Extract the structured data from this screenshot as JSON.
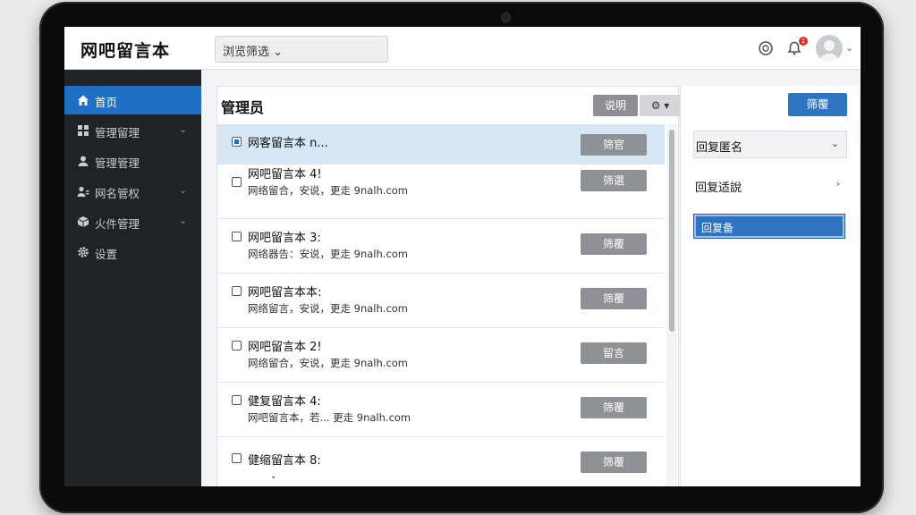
{
  "header": {
    "app_title": "网吧留言本",
    "search_dropdown": "浏览筛选 ⌄",
    "notification_count": "1"
  },
  "sidebar": {
    "items": [
      {
        "label": "首页",
        "icon": "home-icon",
        "active": true,
        "expandable": false
      },
      {
        "label": "管理留理",
        "icon": "grid-icon",
        "active": false,
        "expandable": true
      },
      {
        "label": "管理管理",
        "icon": "user-icon",
        "active": false,
        "expandable": false
      },
      {
        "label": "网名管权",
        "icon": "users-icon",
        "active": false,
        "expandable": true
      },
      {
        "label": "火件管理",
        "icon": "box-icon",
        "active": false,
        "expandable": true
      },
      {
        "label": "设置",
        "icon": "gear-icon",
        "active": false,
        "expandable": false
      }
    ]
  },
  "main": {
    "title": "管理员",
    "btn_primary": "说明",
    "btn_settings": "⚙ ▾",
    "rows": [
      {
        "title": "网客留言本 n...",
        "sub": "",
        "action": "筛官"
      },
      {
        "title": "网吧留言本 4!",
        "sub": "网络留合，安说，更走 9nalh.com",
        "action": "筛選"
      },
      {
        "title": "网吧留言本 3:",
        "sub": "网络器告：安说，更走 9nalh.com",
        "action": "筛覆"
      },
      {
        "title": "网吧留言本本:",
        "sub": "网络留言，安说，更走 9nalh.com",
        "action": "筛覆"
      },
      {
        "title": "网吧留言本 2!",
        "sub": "网络留合，安说，更走 9nalh.com",
        "action": "留言"
      },
      {
        "title": "健复留言本 4:",
        "sub": "网吧留言本，若... 更走 9nalh.com",
        "action": "筛覆"
      },
      {
        "title": "健缩留言本 8:",
        "sub": "",
        "action": "筛覆"
      }
    ]
  },
  "right_panel": {
    "btn": "筛覆",
    "dropdown1": "回复匿名",
    "dropdown2": "回复适說",
    "active_item": "回复备"
  },
  "colors": {
    "accent": "#2f74c0",
    "sidebar_bg": "#1f2328",
    "sidebar_active": "#1f6fc5",
    "selected_row": "#d7e6f5"
  }
}
